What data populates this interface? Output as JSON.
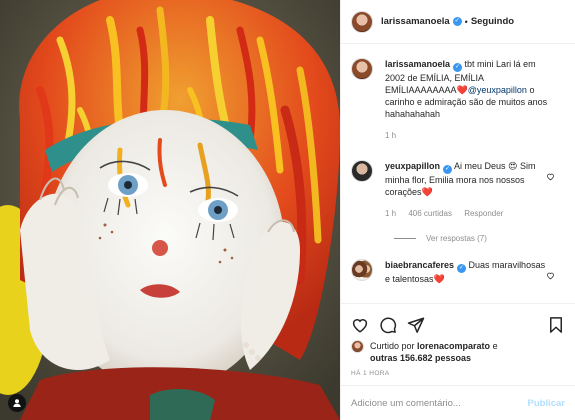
{
  "post": {
    "author": "larissamanoela",
    "follow_status": "Seguindo",
    "separator": "•"
  },
  "caption": {
    "username": "larissamanoela",
    "text_before": " tbt mini Lari lá em 2002 de EMÍLIA, EMÍLIA EMÍLIAAAAAAAA",
    "emoji": "❤️",
    "mention": "@yeuxpapillon",
    "text_after": " o carinho e admiração são de muitos anos hahahahahah",
    "time": "1 h"
  },
  "comments": [
    {
      "username": "yeuxpapillon",
      "text_a": " Ai meu Deus ",
      "emoji_a": "😍",
      "text_b": " Sim minha flor, Emilia mora nos nossos corações",
      "emoji_b": "❤️",
      "time": "1 h",
      "likes": "406 curtidas",
      "reply": "Responder",
      "view_replies": "Ver respostas (7)"
    },
    {
      "username": "biaebrancaferes",
      "text": " Duas maravilhosas e talentosas",
      "emoji": "❤️"
    }
  ],
  "likes_line": {
    "prefix": "Curtido por ",
    "user": "lorenacomparato",
    "middle": " e ",
    "others": "outras 156.682 pessoas"
  },
  "timestamp": "HÁ 1 HORA",
  "add_comment": {
    "placeholder": "Adicione um comentário...",
    "publish_label": "Publicar"
  },
  "icons": {
    "like": "heart-icon",
    "comment": "comment-icon",
    "share": "share-icon",
    "save": "bookmark-icon",
    "tag": "user-tag-icon",
    "verified": "verified-badge-icon"
  },
  "colors": {
    "verified": "#3897f0",
    "mention": "#00376b",
    "publish_disabled": "#b2dffc",
    "muted": "#8e8e8e"
  }
}
